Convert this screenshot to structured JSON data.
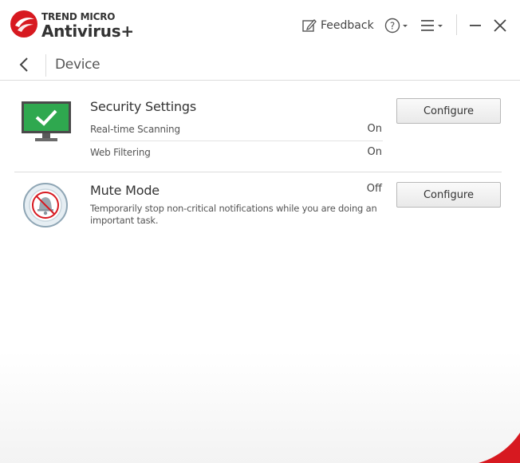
{
  "colors": {
    "brand_red": "#d71920",
    "check_green": "#2fa84f",
    "text": "#333333"
  },
  "titlebar": {
    "brand_top": "TREND MICRO",
    "brand_main": "Antivirus+",
    "feedback_label": "Feedback",
    "feedback_icon": "feedback-edit-icon",
    "help_icon": "help-question-icon",
    "menu_icon": "hamburger-menu-icon",
    "minimize_icon": "minimize-icon",
    "close_icon": "close-icon"
  },
  "nav": {
    "back_icon": "back-chevron-icon",
    "title": "Device"
  },
  "security": {
    "title": "Security Settings",
    "icon": "monitor-check-icon",
    "rows": [
      {
        "label": "Real-time Scanning",
        "value": "On"
      },
      {
        "label": "Web Filtering",
        "value": "On"
      }
    ],
    "button": "Configure"
  },
  "mute": {
    "title": "Mute Mode",
    "icon": "muted-bell-icon",
    "status": "Off",
    "description": "Temporarily stop non-critical notifications while you are doing an important task.",
    "button": "Configure"
  }
}
